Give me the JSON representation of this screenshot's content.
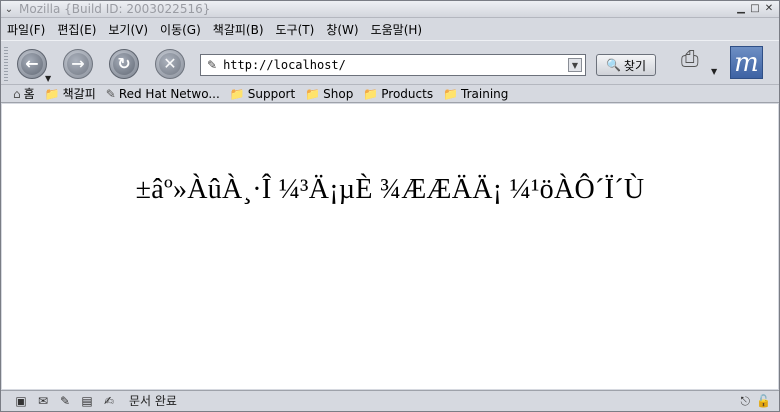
{
  "window": {
    "title": "Mozilla {Build ID: 2003022516}"
  },
  "menubar": [
    "파일(F)",
    "편집(E)",
    "보기(V)",
    "이동(G)",
    "책갈피(B)",
    "도구(T)",
    "창(W)",
    "도움말(H)"
  ],
  "toolbar": {
    "url": "http://localhost/",
    "search_label": "찾기",
    "brand_letter": "m"
  },
  "bookmarks": {
    "home_label": "홈",
    "items": [
      "책갈피",
      "Red Hat Netwo...",
      "Support",
      "Shop",
      "Products",
      "Training"
    ]
  },
  "content": {
    "text": "±âº»ÀûÀ¸·Î ¼³Ä¡µÈ ¾ÆÆÄÄ¡ ¼¹öÀÔ´Ï´Ù"
  },
  "status": {
    "text": "문서 완료"
  }
}
